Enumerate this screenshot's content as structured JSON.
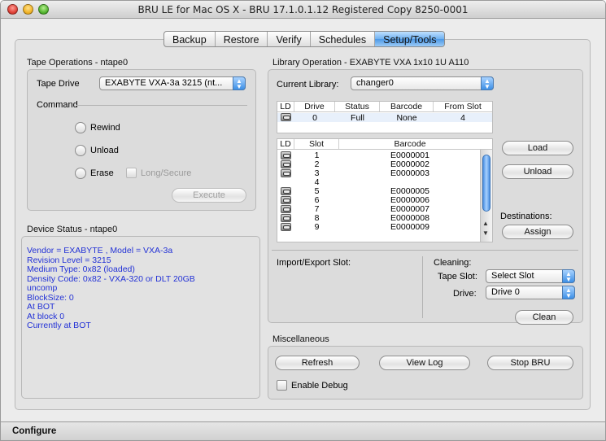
{
  "window": {
    "title": "BRU LE for Mac OS X - BRU 17.1.0.1.12 Registered Copy 8250-0001"
  },
  "tabs": [
    {
      "label": "Backup",
      "active": false
    },
    {
      "label": "Restore",
      "active": false
    },
    {
      "label": "Verify",
      "active": false
    },
    {
      "label": "Schedules",
      "active": false
    },
    {
      "label": "Setup/Tools",
      "active": true
    }
  ],
  "tape_operations": {
    "group_label": "Tape Operations - ntape0",
    "tape_drive_label": "Tape Drive",
    "tape_drive_value": "EXABYTE VXA-3a 3215 (nt...",
    "command_label": "Command",
    "rewind_label": "Rewind",
    "unload_label": "Unload",
    "erase_label": "Erase",
    "long_secure_label": "Long/Secure",
    "execute_label": "Execute"
  },
  "device_status": {
    "group_label": "Device Status - ntape0",
    "lines": [
      "Vendor = EXABYTE , Model = VXA-3a",
      "Revision Level = 3215",
      "Medium Type: 0x82 (loaded)",
      "Density Code: 0x82 - VXA-320 or DLT 20GB",
      "uncomp",
      "BlockSize: 0",
      "At BOT",
      "At block 0",
      "Currently at BOT"
    ]
  },
  "library": {
    "group_label": "Library Operation - EXABYTE VXA 1x10 1U A110",
    "current_library_label": "Current Library:",
    "current_library_value": "changer0",
    "drive_table": {
      "headers": [
        "LD",
        "Drive",
        "Status",
        "Barcode",
        "From Slot"
      ],
      "rows": [
        {
          "drive": "0",
          "status": "Full",
          "barcode": "None",
          "from_slot": "4"
        }
      ]
    },
    "slot_table": {
      "headers": [
        "LD",
        "Slot",
        "Barcode"
      ],
      "rows": [
        {
          "slot": "1",
          "barcode": "E0000001",
          "loaded": true
        },
        {
          "slot": "2",
          "barcode": "E0000002",
          "loaded": true
        },
        {
          "slot": "3",
          "barcode": "E0000003",
          "loaded": true
        },
        {
          "slot": "4",
          "barcode": "",
          "loaded": false
        },
        {
          "slot": "5",
          "barcode": "E0000005",
          "loaded": true
        },
        {
          "slot": "6",
          "barcode": "E0000006",
          "loaded": true
        },
        {
          "slot": "7",
          "barcode": "E0000007",
          "loaded": true
        },
        {
          "slot": "8",
          "barcode": "E0000008",
          "loaded": true
        },
        {
          "slot": "9",
          "barcode": "E0000009",
          "loaded": true
        }
      ]
    },
    "load_label": "Load",
    "unload_label": "Unload",
    "destinations_label": "Destinations:",
    "assign_label": "Assign",
    "import_export_label": "Import/Export Slot:",
    "cleaning_label": "Cleaning:",
    "tape_slot_label": "Tape Slot:",
    "tape_slot_value": "Select Slot",
    "drive_label": "Drive:",
    "drive_value": "Drive 0",
    "clean_label": "Clean"
  },
  "misc": {
    "group_label": "Miscellaneous",
    "refresh_label": "Refresh",
    "view_log_label": "View Log",
    "stop_bru_label": "Stop BRU",
    "enable_debug_label": "Enable Debug"
  },
  "statusbar": {
    "text": "Configure"
  }
}
